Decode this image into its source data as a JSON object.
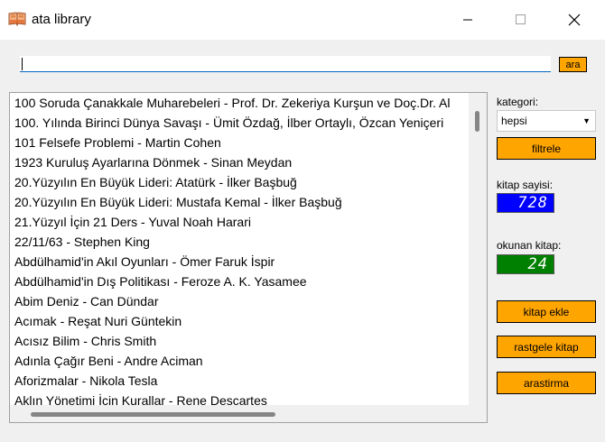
{
  "window": {
    "title": "ata library",
    "icon": "book-icon"
  },
  "search": {
    "value": "",
    "button_label": "ara"
  },
  "books": [
    "100 Soruda Çanakkale Muharebeleri - Prof. Dr. Zekeriya Kurşun ve Doç.Dr. Al",
    "100. Yılında Birinci Dünya Savaşı - Ümit Özdağ, İlber Ortaylı, Özcan Yeniçeri",
    "101 Felsefe Problemi - Martin Cohen",
    "1923 Kuruluş Ayarlarına Dönmek - Sinan Meydan",
    "20.Yüzyılın En Büyük Lideri: Atatürk - İlker Başbuğ",
    "20.Yüzyılın En Büyük Lideri: Mustafa Kemal - İlker Başbuğ",
    "21.Yüzyıl İçin 21 Ders - Yuval Noah Harari",
    "22/11/63 - Stephen King",
    "Abdülhamid'in Akıl Oyunları - Ömer Faruk İspir",
    "Abdülhamid'in Dış Politikası - Feroze A. K. Yasamee",
    "Abim Deniz - Can Dündar",
    "Acımak - Reşat Nuri Güntekin",
    "Acısız Bilim - Chris Smith",
    "Adınla Çağır Beni - Andre Aciman",
    "Aforizmalar - Nikola Tesla",
    "Aklın Yönetimi İçin Kurallar - Rene Descartes"
  ],
  "sidebar": {
    "category_label": "kategori:",
    "category_selected": "hepsi",
    "filter_button": "filtrele",
    "book_count_label": "kitap sayisi:",
    "book_count": "728",
    "read_label": "okunan kitap:",
    "read_count": "24",
    "add_button": "kitap ekle",
    "random_button": "rastgele kitap",
    "research_button": "arastirma"
  },
  "colors": {
    "accent": "#ffa500",
    "count_bg": "#0000ff",
    "read_bg": "#008000"
  }
}
